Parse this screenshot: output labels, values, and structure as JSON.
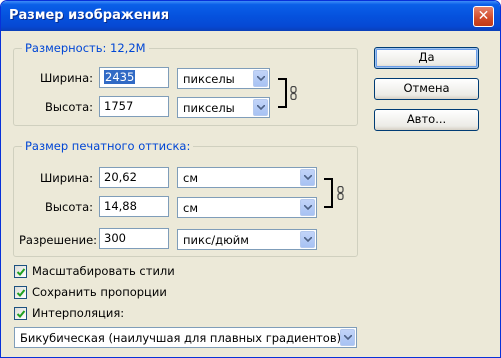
{
  "window": {
    "title": "Размер изображения",
    "close_glyph": "✕"
  },
  "pixel_dimensions": {
    "legend": "Размерность:  12,2M",
    "width_label": "Ширина:",
    "width_value": "2435",
    "width_unit": "пикселы",
    "height_label": "Высота:",
    "height_value": "1757",
    "height_unit": "пикселы"
  },
  "document_size": {
    "legend": "Размер печатного оттиска:",
    "width_label": "Ширина:",
    "width_value": "20,62",
    "width_unit": "см",
    "height_label": "Высота:",
    "height_value": "14,88",
    "height_unit": "см",
    "resolution_label": "Разрешение:",
    "resolution_value": "300",
    "resolution_unit": "пикс/дюйм"
  },
  "buttons": {
    "ok": "Да",
    "cancel": "Отмена",
    "auto": "Авто..."
  },
  "options": {
    "scale_styles": {
      "label": "Масштабировать стили",
      "checked": true
    },
    "constrain_proportions": {
      "label": "Сохранить пропорции",
      "checked": true
    },
    "resample": {
      "label": "Интерполяция:",
      "checked": true
    },
    "resample_method": "Бикубическая (наилучшая для плавных градиентов)"
  },
  "icons": {
    "link_icon": "chain-link",
    "dropdown_icon": "chevron-down",
    "check_icon": "checkmark"
  },
  "colors": {
    "title_bar": "#0552de",
    "legend_text": "#0046d5",
    "dialog_bg": "#ece9d8",
    "selection": "#316ac5",
    "check_green": "#21a121"
  }
}
